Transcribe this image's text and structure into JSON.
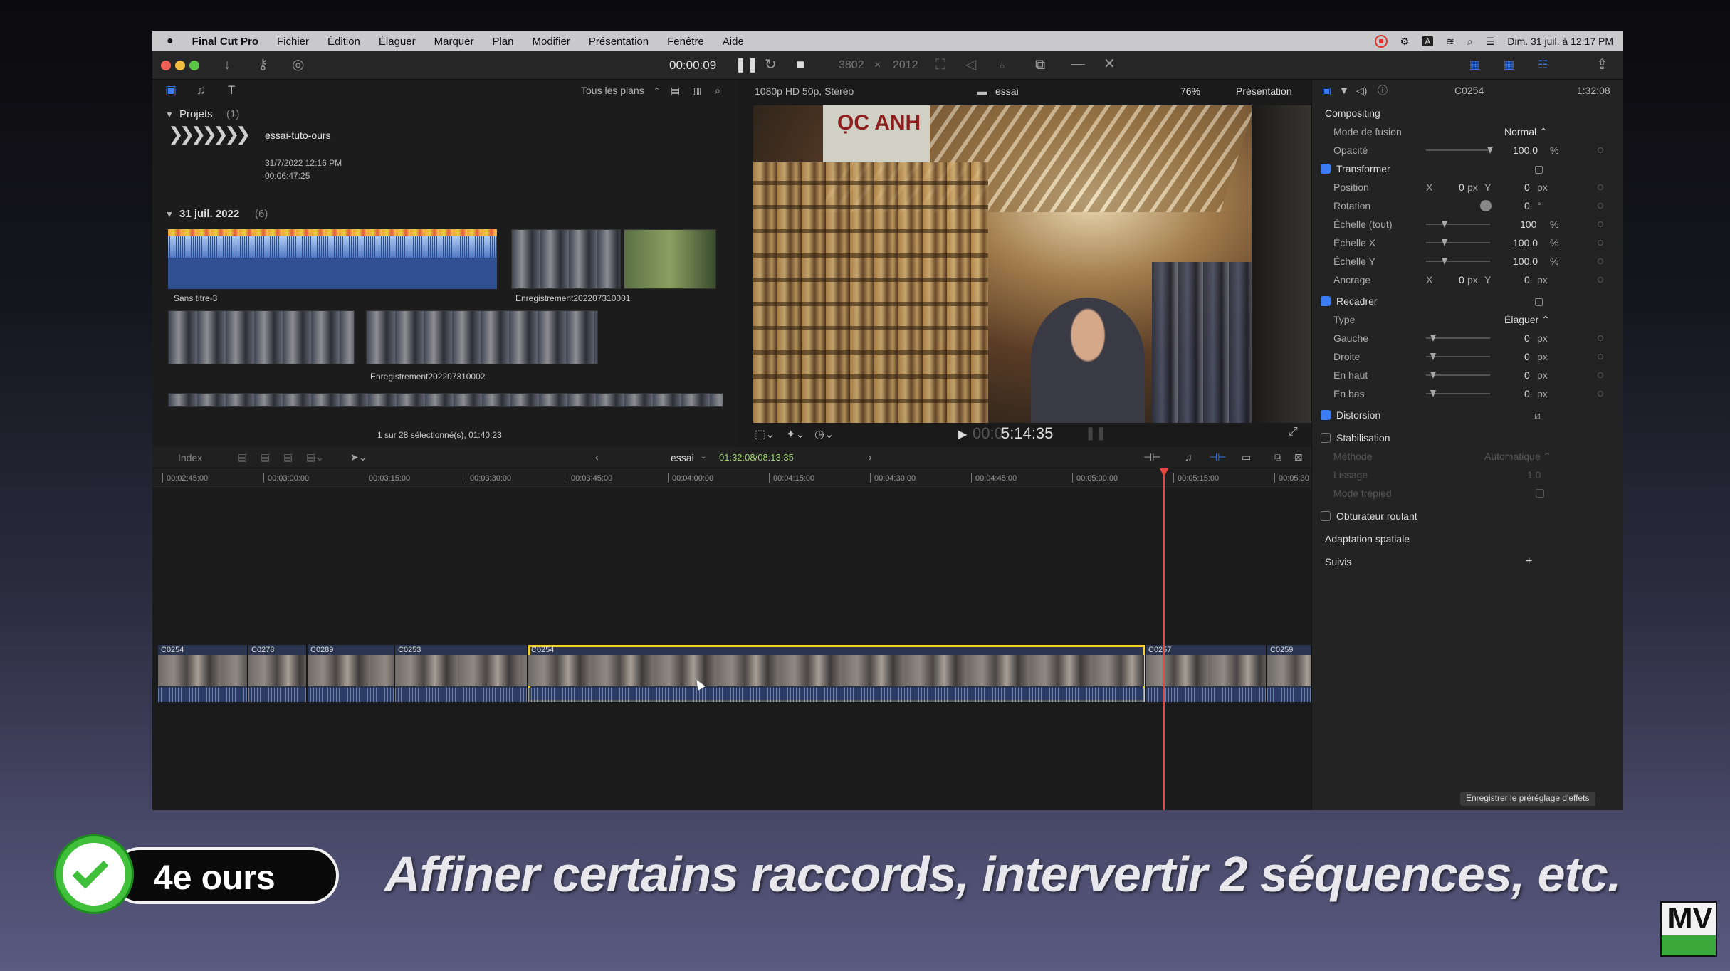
{
  "menubar": {
    "app": "Final Cut Pro",
    "items": [
      "Fichier",
      "Édition",
      "Élaguer",
      "Marquer",
      "Plan",
      "Modifier",
      "Présentation",
      "Fenêtre",
      "Aide"
    ],
    "clock": "Dim. 31 juil. à 12:17 PM"
  },
  "toolbar": {
    "timecode": "00:00:09",
    "width": "3802",
    "height": "2012",
    "x_sep": "×"
  },
  "browser": {
    "filter": "Tous les plans",
    "projects_label": "Projets",
    "projects_count": "(1)",
    "project_name": "essai-tuto-ours",
    "project_date": "31/7/2022 12:16 PM",
    "project_duration": "00:06:47:25",
    "event_label": "31 juil. 2022",
    "event_count": "(6)",
    "clip1": "Sans titre-3",
    "clip2": "Enregistrement202207310001",
    "clip3": "Enregistrement202207310002",
    "status": "1 sur 28 sélectionné(s), 01:40:23"
  },
  "viewer": {
    "format": "1080p HD 50p, Stéréo",
    "project": "essai",
    "zoom": "76%",
    "view_menu": "Présentation",
    "timecode_dim": "00:0",
    "timecode": "5:14:35"
  },
  "timeline": {
    "index": "Index",
    "project": "essai",
    "duration": "01:32:08/08:13:35",
    "ticks": [
      "00:02:45:00",
      "00:03:00:00",
      "00:03:15:00",
      "00:03:30:00",
      "00:03:45:00",
      "00:04:00:00",
      "00:04:15:00",
      "00:04:30:00",
      "00:04:45:00",
      "00:05:00:00",
      "00:05:15:00",
      "00:05:30"
    ],
    "clips": [
      "C0254",
      "C0278",
      "C0289",
      "C0253",
      "C0254",
      "C0257",
      "C0259"
    ]
  },
  "inspector": {
    "clip": "C0254",
    "duration": "1:32:08",
    "compositing": "Compositing",
    "blend_label": "Mode de fusion",
    "blend_value": "Normal ⌃",
    "opacity_label": "Opacité",
    "opacity_value": "100.0",
    "pct": "%",
    "transform": "Transformer",
    "position": "Position",
    "x": "X",
    "y": "Y",
    "zero": "0",
    "px": "px",
    "rotation": "Rotation",
    "rot_value": "0",
    "deg": "°",
    "scale_all": "Échelle (tout)",
    "scale_all_value": "100",
    "scale_x": "Échelle X",
    "scale_x_value": "100.0",
    "scale_y": "Échelle Y",
    "scale_y_value": "100.0",
    "anchor": "Ancrage",
    "crop": "Recadrer",
    "type_label": "Type",
    "type_value": "Élaguer ⌃",
    "left": "Gauche",
    "right": "Droite",
    "top": "En haut",
    "bottom": "En bas",
    "distortion": "Distorsion",
    "stabilization": "Stabilisation",
    "method": "Méthode",
    "method_value": "Automatique ⌃",
    "smoothing": "Lissage",
    "smoothing_value": "1.0",
    "tripod": "Mode trépied",
    "rolling": "Obturateur roulant",
    "spatial": "Adaptation spatiale",
    "tracking": "Suivis",
    "plus": "+",
    "save_preset": "Enregistrer le préréglage d'effets"
  },
  "overlay": {
    "badge": "4e ours",
    "caption": "Affiner certains raccords, intervertir 2 séquences, etc.",
    "logo": "MV"
  },
  "colors": {
    "accent": "#3b7bf3",
    "selection": "#f3d12b",
    "playhead": "#e5483e",
    "badge_green": "#3fbf3a"
  }
}
